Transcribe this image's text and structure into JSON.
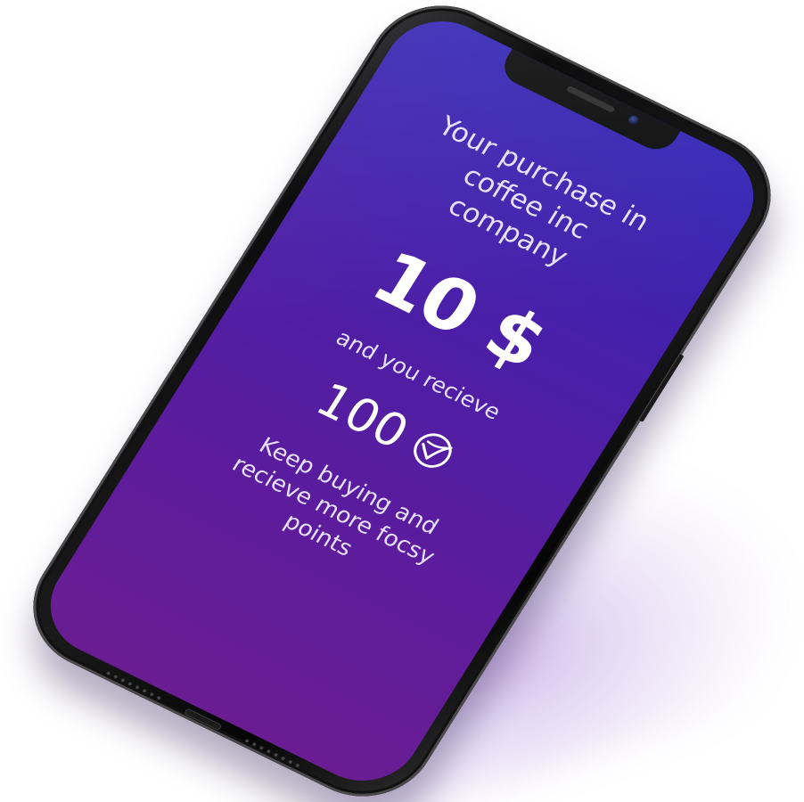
{
  "screen": {
    "title": "Your purchase in coffee inc company",
    "amount": "10 $",
    "subtitle": "and you recieve",
    "points_value": "100",
    "points_icon": "check-circle-icon",
    "footer_text": "Keep buying and recieve more focsy points"
  },
  "colors": {
    "gradient_top": "#3224b4",
    "gradient_bottom": "#6a1d92",
    "text_primary": "#ffffff",
    "text_secondary": "#e6e0ff"
  }
}
